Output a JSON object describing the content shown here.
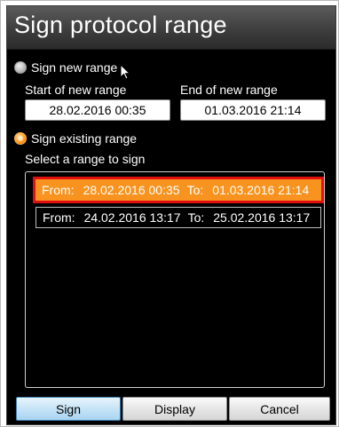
{
  "dialog": {
    "title": "Sign protocol range"
  },
  "options": {
    "sign_new_range_label": "Sign new range",
    "sign_existing_range_label": "Sign existing range",
    "selected": "sign_existing_range"
  },
  "new_range": {
    "start_label": "Start of new range",
    "start_value": "28.02.2016 00:35",
    "end_label": "End of new range",
    "end_value": "01.03.2016 21:14"
  },
  "range_list": {
    "label": "Select a range to sign",
    "items": [
      {
        "from_label": "From:",
        "from": "28.02.2016 00:35",
        "to_label": "To:",
        "to": "01.03.2016 21:14",
        "selected": true
      },
      {
        "from_label": "From:",
        "from": "24.02.2016 13:17",
        "to_label": "To:",
        "to": "25.02.2016 13:17",
        "selected": false
      }
    ]
  },
  "buttons": {
    "sign": "Sign",
    "display": "Display",
    "cancel": "Cancel"
  },
  "colors": {
    "selection": "#f7931e",
    "selection_outline": "#e01010",
    "background": "#000000"
  },
  "icons": {
    "cursor": "mouse-pointer-icon"
  }
}
